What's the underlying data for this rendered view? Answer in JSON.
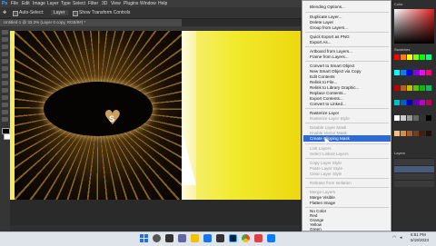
{
  "app": {
    "menubar": [
      "File",
      "Edit",
      "Image",
      "Layer",
      "Type",
      "Select",
      "Filter",
      "3D",
      "View",
      "Plugins",
      "Window",
      "Help"
    ],
    "options": {
      "auto_select_label": "Auto-Select:",
      "auto_select_value": "Layer",
      "show_transform": "Show Transform Controls"
    },
    "document_tab": "Untitled-1 @ 33.3% (Layer 0 copy, RGB/8#) *",
    "colors": {
      "accent": "#2e6ad3",
      "yellow": "#f2ea2c",
      "dark": "#140c04"
    }
  },
  "context_menu": {
    "items": [
      {
        "label": "Blending Options...",
        "enabled": true
      },
      {
        "label": "Duplicate Layer...",
        "enabled": true
      },
      {
        "label": "Delete Layer",
        "enabled": true
      },
      {
        "label": "Group from Layers...",
        "enabled": true
      },
      {
        "label": "Quick Export as PNG",
        "enabled": true
      },
      {
        "label": "Export As...",
        "enabled": true
      },
      {
        "label": "Artboard from Layers...",
        "enabled": true
      },
      {
        "label": "Frame from Layers...",
        "enabled": true
      },
      {
        "label": "Convert to Smart Object",
        "enabled": true
      },
      {
        "label": "New Smart Object via Copy",
        "enabled": true
      },
      {
        "label": "Edit Contents",
        "enabled": true
      },
      {
        "label": "Relink to File...",
        "enabled": true
      },
      {
        "label": "Relink to Library Graphic...",
        "enabled": true
      },
      {
        "label": "Replace Contents...",
        "enabled": true
      },
      {
        "label": "Export Contents...",
        "enabled": true
      },
      {
        "label": "Convert to Linked...",
        "enabled": true
      },
      {
        "label": "Rasterize Layer",
        "enabled": true
      },
      {
        "label": "Rasterize Layer Style",
        "enabled": false
      },
      {
        "label": "Disable Layer Mask",
        "enabled": false
      },
      {
        "label": "Enable Vector Mask",
        "enabled": false
      },
      {
        "label": "Create Clipping Mask",
        "enabled": true,
        "selected": true
      },
      {
        "label": "Link Layers",
        "enabled": false
      },
      {
        "label": "Select Linked Layers",
        "enabled": false
      },
      {
        "label": "Copy Layer Style",
        "enabled": false
      },
      {
        "label": "Paste Layer Style",
        "enabled": false
      },
      {
        "label": "Clear Layer Style",
        "enabled": false
      },
      {
        "label": "Release from Isolation",
        "enabled": false
      },
      {
        "label": "Merge Layers",
        "enabled": false
      },
      {
        "label": "Merge Visible",
        "enabled": true
      },
      {
        "label": "Flatten Image",
        "enabled": true
      },
      {
        "label": "No Color",
        "enabled": true
      },
      {
        "label": "Red",
        "enabled": true
      },
      {
        "label": "Orange",
        "enabled": true
      },
      {
        "label": "Yellow",
        "enabled": true
      },
      {
        "label": "Green",
        "enabled": true
      }
    ]
  },
  "canvas": {
    "heart_letter": "S"
  },
  "panels": {
    "tabs": [
      "Color",
      "Swatches",
      "Layers"
    ]
  },
  "taskbar": {
    "time": "6:51 PM",
    "date": "5/19/2023"
  }
}
